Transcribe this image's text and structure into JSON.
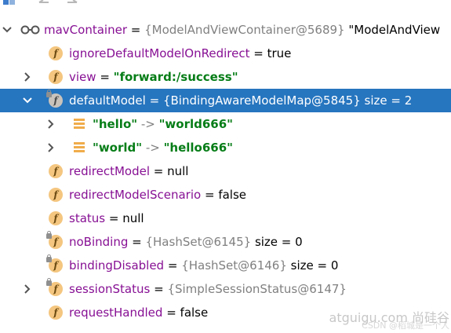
{
  "root": {
    "name": "mavContainer",
    "eq": " = ",
    "value": "{ModelAndViewContainer@5689}",
    "extra": " \"ModelAndView"
  },
  "rows": {
    "ignoreDefault": {
      "name": "ignoreDefaultModelOnRedirect",
      "eq": " = ",
      "value": "true"
    },
    "view": {
      "name": "view",
      "eq": " = ",
      "value": "\"forward:/success\""
    },
    "defaultModel": {
      "name": "defaultModel",
      "eq": " = ",
      "value": "{BindingAwareModelMap@5845}",
      "size": "  size = 2"
    },
    "hello": {
      "key": "\"hello\"",
      "arrow": " -> ",
      "value": "\"world666\""
    },
    "world": {
      "key": "\"world\"",
      "arrow": " -> ",
      "value": "\"hello666\""
    },
    "redirectModel": {
      "name": "redirectModel",
      "eq": " = ",
      "value": "null"
    },
    "redirectModelScenario": {
      "name": "redirectModelScenario",
      "eq": " = ",
      "value": "false"
    },
    "status": {
      "name": "status",
      "eq": " = ",
      "value": "null"
    },
    "noBinding": {
      "name": "noBinding",
      "eq": " = ",
      "value": "{HashSet@6145}",
      "size": "  size = 0"
    },
    "bindingDisabled": {
      "name": "bindingDisabled",
      "eq": " = ",
      "value": "{HashSet@6146}",
      "size": "  size = 0"
    },
    "sessionStatus": {
      "name": "sessionStatus",
      "eq": " = ",
      "value": "{SimpleSessionStatus@6147}"
    },
    "requestHandled": {
      "name": "requestHandled",
      "eq": " = ",
      "value": "false"
    }
  },
  "field_icon_glyph": "f",
  "watermark": {
    "main": "atguigu.com 尚硅谷",
    "sub": "CSDN @稻城是一个人"
  },
  "colors": {
    "selection": "#2675bf",
    "field_name": "#871094",
    "string": "#067d17",
    "object": "#808080",
    "field_icon": "#f4c67f"
  }
}
